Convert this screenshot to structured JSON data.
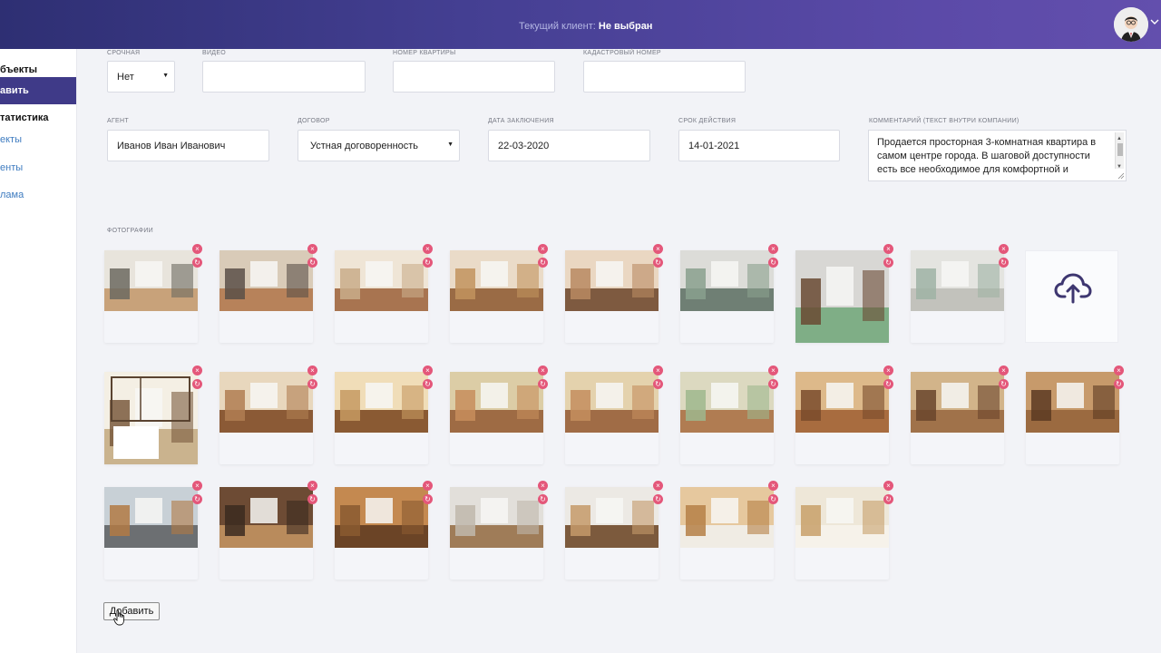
{
  "header": {
    "client_label": "Текущий клиент:",
    "client_value": "Не выбран"
  },
  "sidebar": {
    "items": [
      {
        "label": "бъекты",
        "style": "head"
      },
      {
        "label": "авить",
        "style": "active"
      },
      {
        "label": "татистика",
        "style": "head"
      },
      {
        "label": "екты",
        "style": "link"
      },
      {
        "label": "енты",
        "style": "link"
      },
      {
        "label": "лама",
        "style": "link"
      }
    ]
  },
  "form": {
    "urgent": {
      "label": "СРОЧНАЯ",
      "value": "Нет"
    },
    "video": {
      "label": "ВИДЕО",
      "value": ""
    },
    "apartment_number": {
      "label": "НОМЕР КВАРТИРЫ",
      "value": ""
    },
    "cadastral_number": {
      "label": "КАДАСТРОВЫЙ НОМЕР",
      "value": ""
    },
    "agent": {
      "label": "АГЕНТ",
      "value": "Иванов Иван Иванович"
    },
    "contract": {
      "label": "ДОГОВОР",
      "value": "Устная договоренность"
    },
    "conclusion_date": {
      "label": "ДАТА ЗАКЛЮЧЕНИЯ",
      "value": "22-03-2020"
    },
    "validity": {
      "label": "СРОК ДЕЙСТВИЯ",
      "value": "14-01-2021"
    },
    "comment": {
      "label": "КОММЕНТАРИЙ (ТЕКСТ ВНУТРИ КОМПАНИИ)",
      "value": "Продается просторная 3-комнатная квартира в самом центре города. В шаговой доступности есть все необходимое для комфортной и"
    }
  },
  "photos": {
    "label": "ФОТОГРАФИИ",
    "delete_icon": "close-icon",
    "rotate_icon": "rotate-icon",
    "upload_icon": "cloud-upload-icon",
    "rows": [
      [
        {
          "kind": "kitchen-white",
          "tall": false
        },
        {
          "kind": "kitchen-brick",
          "tall": false
        },
        {
          "kind": "room-beige",
          "tall": false
        },
        {
          "kind": "kitchen-wood",
          "tall": false
        },
        {
          "kind": "kitchen-pole",
          "tall": false
        },
        {
          "kind": "bathroom-green",
          "tall": false
        },
        {
          "kind": "bathroom-shower",
          "tall": true
        },
        {
          "kind": "bathroom-white",
          "tall": false
        }
      ],
      [
        {
          "kind": "floorplan",
          "tall": true
        },
        {
          "kind": "hall-brick",
          "tall": false
        },
        {
          "kind": "room-empty",
          "tall": false
        },
        {
          "kind": "kids-room",
          "tall": false
        },
        {
          "kind": "kids-room-2",
          "tall": false
        },
        {
          "kind": "kids-room-3",
          "tall": false
        },
        {
          "kind": "corridor-door",
          "tall": false
        },
        {
          "kind": "corridor-brick",
          "tall": false
        },
        {
          "kind": "corridor-dark",
          "tall": false
        }
      ],
      [
        {
          "kind": "balcony",
          "tall": false
        },
        {
          "kind": "sauna-door",
          "tall": false
        },
        {
          "kind": "sauna",
          "tall": false
        },
        {
          "kind": "room-wallpaper",
          "tall": false
        },
        {
          "kind": "room-ac",
          "tall": false
        },
        {
          "kind": "bathroom-tub",
          "tall": false
        },
        {
          "kind": "bathroom-sink",
          "tall": false
        }
      ]
    ]
  },
  "add_button": {
    "label": "Добавить"
  }
}
